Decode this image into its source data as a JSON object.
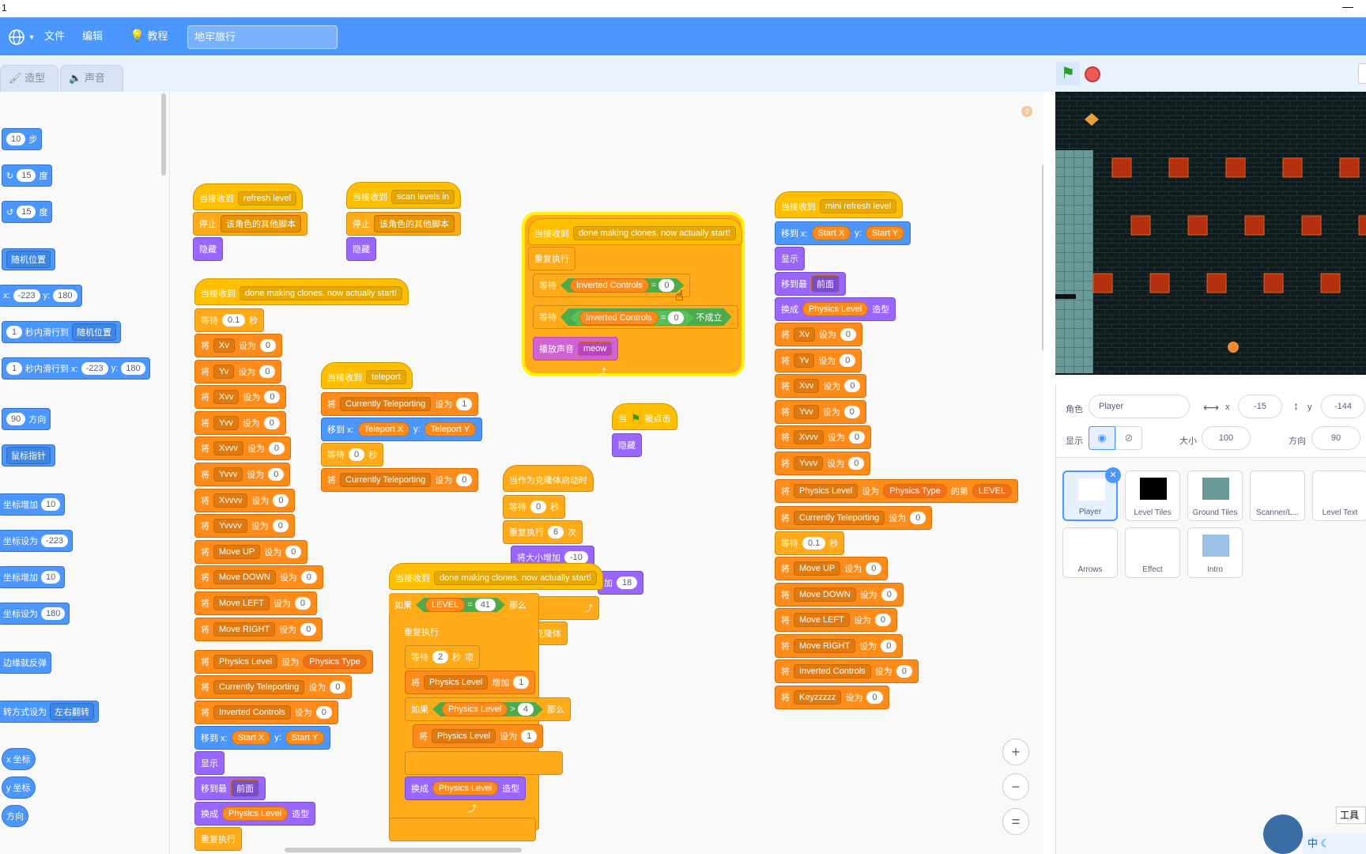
{
  "window": {
    "title": "1",
    "close_glyph": "—"
  },
  "menubar": {
    "file": "文件",
    "edit": "编辑",
    "tutorials": "教程",
    "project_title": "地牢旅行",
    "globe_icon": "globe-icon"
  },
  "tabs": {
    "costumes": "造型",
    "sounds": "声音"
  },
  "palette": {
    "move_steps": "10",
    "move_steps_unit": "步",
    "turn_right": "15",
    "turn_right_unit": "度",
    "turn_left": "15",
    "turn_left_unit": "度",
    "goto_random": "随机位置",
    "goto_x_label": "x:",
    "goto_x": "-223",
    "goto_y_label": "y:",
    "goto_y": "180",
    "glide_secs": "1",
    "glide_label": "秒内滑行到",
    "glide_target": "随机位置",
    "glide2_secs": "1",
    "glide2_label": "秒内滑行到 x:",
    "glide2_x": "-223",
    "glide2_y_label": "y:",
    "glide2_y": "180",
    "direction_val": "90",
    "direction_label": "方向",
    "point_towards": "鼠标指针",
    "change_x_label": "坐标增加",
    "change_x": "10",
    "set_x_label": "坐标设为",
    "set_x": "-223",
    "change_y_label": "坐标增加",
    "change_y": "10",
    "set_y_label": "坐标设为",
    "set_y": "180",
    "bounce": "边缘就反弹",
    "rotation_label": "转方式设为",
    "rotation_value": "左右翻转",
    "x_pos": "x 坐标",
    "y_pos": "y 坐标",
    "direction_rep": "方向"
  },
  "scripts": {
    "s1": {
      "hat": "当接收到",
      "msg": "refresh level",
      "stop": "停止",
      "stop_opt": "该角色的其他脚本",
      "hide": "隐藏"
    },
    "s2": {
      "hat": "当接收到",
      "msg": "scan levels in",
      "stop": "停止",
      "stop_opt": "该角色的其他脚本",
      "hide": "隐藏"
    },
    "s3": {
      "hat": "当接收到",
      "msg": "done making clones. now actually start!",
      "forever": "重复执行",
      "wait": "等待",
      "var": "Inverted Controls",
      "eq": "=",
      "val": "0",
      "wait2": "等待",
      "var2": "Inverted Controls",
      "eq2": "=",
      "val2": "0",
      "not": "不成立",
      "play": "播放声音",
      "sound": "meow"
    },
    "s4": {
      "hat": "当接收到",
      "msg": "done making clones. now actually start!",
      "wait": "等待",
      "wait_val": "0.1",
      "wait_unit": "秒",
      "sets": [
        {
          "k": "将",
          "v": "Xv",
          "to": "设为",
          "n": "0"
        },
        {
          "k": "将",
          "v": "Yv",
          "to": "设为",
          "n": "0"
        },
        {
          "k": "将",
          "v": "Xvv",
          "to": "设为",
          "n": "0"
        },
        {
          "k": "将",
          "v": "Yvv",
          "to": "设为",
          "n": "0"
        },
        {
          "k": "将",
          "v": "Xvvv",
          "to": "设为",
          "n": "0"
        },
        {
          "k": "将",
          "v": "Yvvv",
          "to": "设为",
          "n": "0"
        },
        {
          "k": "将",
          "v": "Xvvvv",
          "to": "设为",
          "n": "0"
        },
        {
          "k": "将",
          "v": "Yvvvv",
          "to": "设为",
          "n": "0"
        },
        {
          "k": "将",
          "v": "Move UP",
          "to": "设为",
          "n": "0"
        },
        {
          "k": "将",
          "v": "Move DOWN",
          "to": "设为",
          "n": "0"
        },
        {
          "k": "将",
          "v": "Move LEFT",
          "to": "设为",
          "n": "0"
        },
        {
          "k": "将",
          "v": "Move RIGHT",
          "to": "设为",
          "n": "0"
        }
      ],
      "phys": "将",
      "phys_var": "Physics Level",
      "phys_to": "设为",
      "phys_rep": "Physics Type",
      "tele": "将",
      "tele_var": "Currently Teleporting",
      "tele_to": "设为",
      "tele_n": "0",
      "inv": "将",
      "inv_var": "Inverted Controls",
      "inv_to": "设为",
      "inv_n": "0",
      "goto": "移到 x:",
      "gx": "Start X",
      "gy_label": "y:",
      "gy": "Start Y",
      "show": "显示",
      "layer": "移到最",
      "layer_opt": "前面",
      "switch": "换成",
      "costume": "Physics Level",
      "costume_suffix": "造型",
      "forever": "重复执行"
    },
    "s5": {
      "hat": "当接收到",
      "msg": "teleport",
      "set": "将",
      "var": "Currently Teleporting",
      "to": "设为",
      "n": "1",
      "goto": "移到 x:",
      "gx": "Teleport X",
      "gy_label": "y:",
      "gy": "Teleport Y",
      "wait": "等待",
      "wait_val": "0",
      "wait_unit": "秒",
      "set2": "将",
      "var2": "Currently Teleporting",
      "to2": "设为",
      "n2": "0"
    },
    "s6": {
      "hat": "当",
      "flag_label": "被点击",
      "hide": "隐藏"
    },
    "s7": {
      "hat": "当作为克隆体启动时",
      "wait": "等待",
      "wait_val": "0",
      "wait_unit": "秒",
      "repeat": "重复执行",
      "repeat_n": "6",
      "repeat_unit": "次",
      "grow": "将大小增加",
      "grow_n": "-10",
      "add_label": "加",
      "add_n": "18",
      "delete": "删除此克隆体"
    },
    "s8": {
      "hat": "当接收到",
      "msg": "done making clones. now actually start!",
      "if": "如果",
      "level": "LEVEL",
      "eq": "=",
      "lv": "41",
      "then": "那么",
      "forever": "重复执行",
      "wait": "等待",
      "wait_val": "2",
      "wait_unit": "秒",
      "item_tail": "项",
      "change": "将",
      "cvar": "Physics Level",
      "inc": "增加",
      "inc_n": "1",
      "if2": "如果",
      "pl": "Physics Level",
      "gt": ">",
      "gtn": "4",
      "then2": "那么",
      "set": "将",
      "svar": "Physics Level",
      "sto": "设为",
      "sn": "1",
      "switch": "换成",
      "costume": "Physics Level",
      "costume_suffix": "造型"
    },
    "s9": {
      "hat": "当接收到",
      "msg": "mini refresh level",
      "goto": "移到 x:",
      "gx": "Start X",
      "gy_label": "y:",
      "gy": "Start Y",
      "show": "显示",
      "layer": "移到最",
      "layer_opt": "前面",
      "switch": "换成",
      "costume": "Physics Level",
      "costume_suffix": "造型",
      "sets": [
        {
          "k": "将",
          "v": "Xv",
          "to": "设为",
          "n": "0"
        },
        {
          "k": "将",
          "v": "Yv",
          "to": "设为",
          "n": "0"
        },
        {
          "k": "将",
          "v": "Xvv",
          "to": "设为",
          "n": "0"
        },
        {
          "k": "将",
          "v": "Yvv",
          "to": "设为",
          "n": "0"
        },
        {
          "k": "将",
          "v": "Xvvv",
          "to": "设为",
          "n": "0"
        },
        {
          "k": "将",
          "v": "Yvvv",
          "to": "设为",
          "n": "0"
        }
      ],
      "phys": "将",
      "phys_var": "Physics Level",
      "phys_to": "设为",
      "phys_rep": "Physics Type",
      "of": "的第",
      "of_rep": "LEVEL",
      "tele": "将",
      "tele_var": "Currently Teleporting",
      "tele_to": "设为",
      "tele_n": "0",
      "wait": "等待",
      "wait_val": "0.1",
      "wait_unit": "秒",
      "sets2": [
        {
          "k": "将",
          "v": "Move UP",
          "to": "设为",
          "n": "0"
        },
        {
          "k": "将",
          "v": "Move DOWN",
          "to": "设为",
          "n": "0"
        },
        {
          "k": "将",
          "v": "Move LEFT",
          "to": "设为",
          "n": "0"
        },
        {
          "k": "将",
          "v": "Move RIGHT",
          "to": "设为",
          "n": "0"
        },
        {
          "k": "将",
          "v": "Inverted Controls",
          "to": "设为",
          "n": "0"
        },
        {
          "k": "将",
          "v": "Keyzzzzz",
          "to": "设为",
          "n": "0"
        }
      ]
    }
  },
  "zoom": {
    "in": "+",
    "out": "−",
    "reset": "="
  },
  "sprite_info": {
    "sprite_label": "角色",
    "sprite_name": "Player",
    "x_label": "x",
    "x": "-15",
    "y_label": "y",
    "y": "-144",
    "show_label": "显示",
    "size_label": "大小",
    "size": "100",
    "dir_label": "方向",
    "dir": "90"
  },
  "sprites": [
    {
      "name": "Player",
      "selected": true
    },
    {
      "name": "Level Tiles"
    },
    {
      "name": "Ground Tiles"
    },
    {
      "name": "Scanner/L..."
    },
    {
      "name": "Level Text"
    },
    {
      "name": "Arrows"
    },
    {
      "name": "Effect"
    },
    {
      "name": "Intro"
    }
  ],
  "taskbar": {
    "tool": "工具箱",
    "ime": "中"
  },
  "colors": {
    "menubar": "#4c97ff",
    "events": "#ffbf00",
    "control": "#ffab19",
    "variables": "#ff8c1a",
    "motion": "#4c97ff",
    "looks": "#9966ff",
    "sound": "#cf63cf",
    "operators": "#59c059",
    "lava": "#b33010"
  }
}
